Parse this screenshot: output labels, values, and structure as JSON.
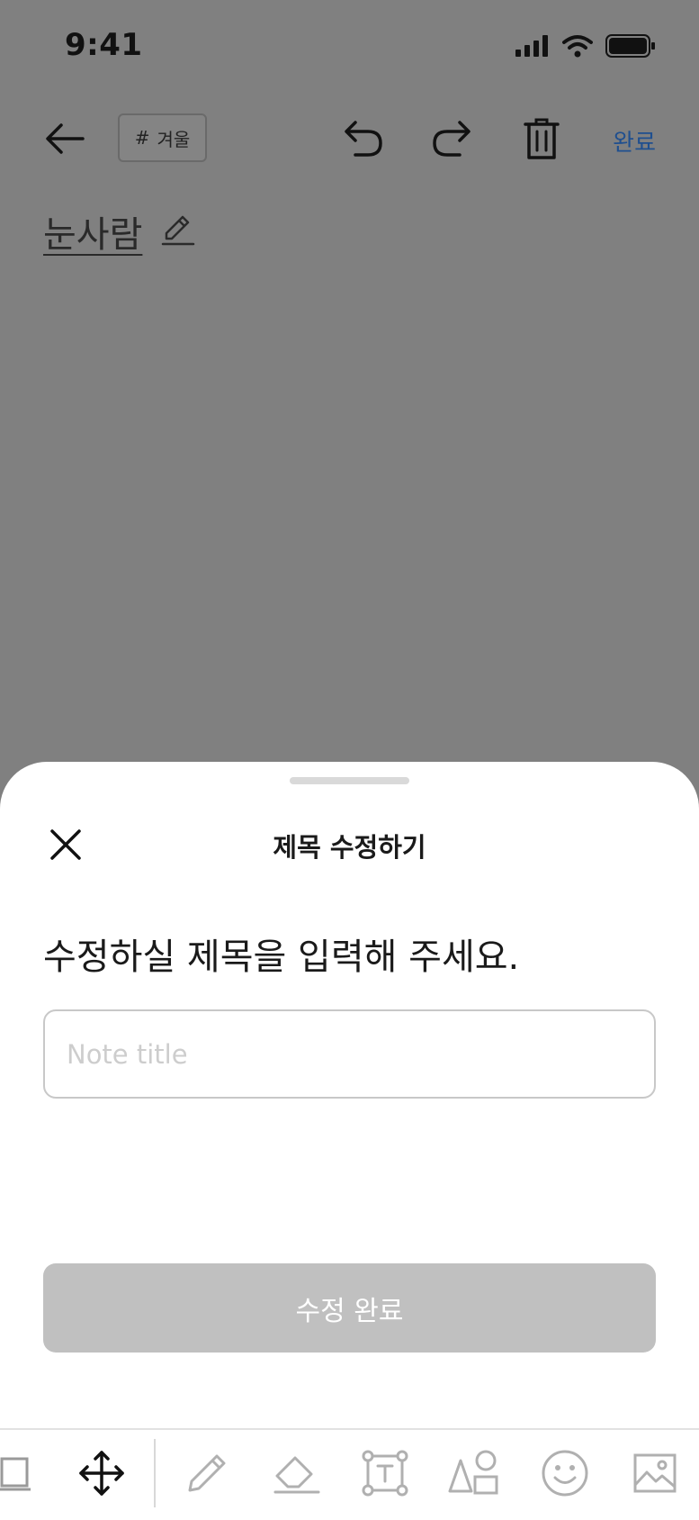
{
  "status_bar": {
    "time": "9:41"
  },
  "header": {
    "tag_hash": "#",
    "tag_label": "겨울",
    "done_label": "완료",
    "icons": [
      "back-arrow-icon",
      "undo-icon",
      "redo-icon",
      "trash-icon"
    ]
  },
  "note": {
    "title": "눈사람"
  },
  "sheet": {
    "title": "제목 수정하기",
    "prompt": "수정하실 제목을 입력해 주세요.",
    "input": {
      "value": "",
      "placeholder": "Note title"
    },
    "submit_label": "수정 완료"
  },
  "tools": [
    "page-icon",
    "move-icon",
    "pen-icon",
    "eraser-icon",
    "text-box-icon",
    "shapes-icon",
    "sticker-icon",
    "image-icon"
  ],
  "colors": {
    "accent_link": "#1f4f8f",
    "overlay": "#808080",
    "button_disabled": "#c0c0c0"
  }
}
